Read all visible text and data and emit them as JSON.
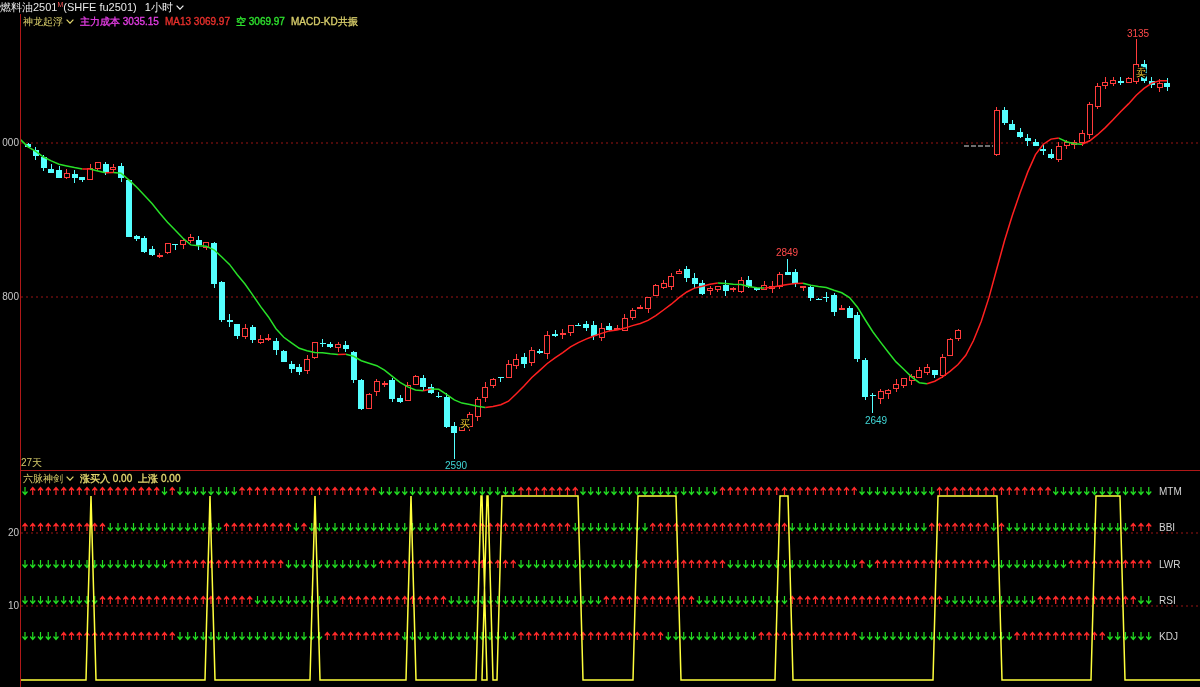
{
  "title": {
    "text": "燃料油2501$^{M}$(SHFE fu2501)",
    "period": "1小时"
  },
  "price_panel": {
    "indicator": "神龙起浮",
    "legend": [
      {
        "label": "主力成本 3035.15",
        "color": "#e23ce2"
      },
      {
        "label": "MA13 3069.97",
        "color": "#e8302c"
      },
      {
        "label": "空 3069.97",
        "color": "#2ee02e"
      },
      {
        "label": "MACD-KD共振",
        "color": "#d6cc6a"
      }
    ],
    "axis_labels": [
      "000",
      "800"
    ],
    "markers": [
      {
        "kind": "high",
        "text": "3135"
      },
      {
        "kind": "sell",
        "text": "卖"
      },
      {
        "kind": "high",
        "text": "2849"
      },
      {
        "kind": "low",
        "text": "2649"
      },
      {
        "kind": "buy",
        "text": "买"
      },
      {
        "kind": "low",
        "text": "2590"
      }
    ],
    "footer": "27天"
  },
  "signal_panel": {
    "indicator": "六脉神剑",
    "legend": [
      "涨买入 0.00",
      "上涨 0.00"
    ],
    "axis_labels": [
      "20",
      "10"
    ],
    "rows": [
      "MTM",
      "BBI",
      "LWR",
      "RSI",
      "KDJ"
    ]
  }
}
